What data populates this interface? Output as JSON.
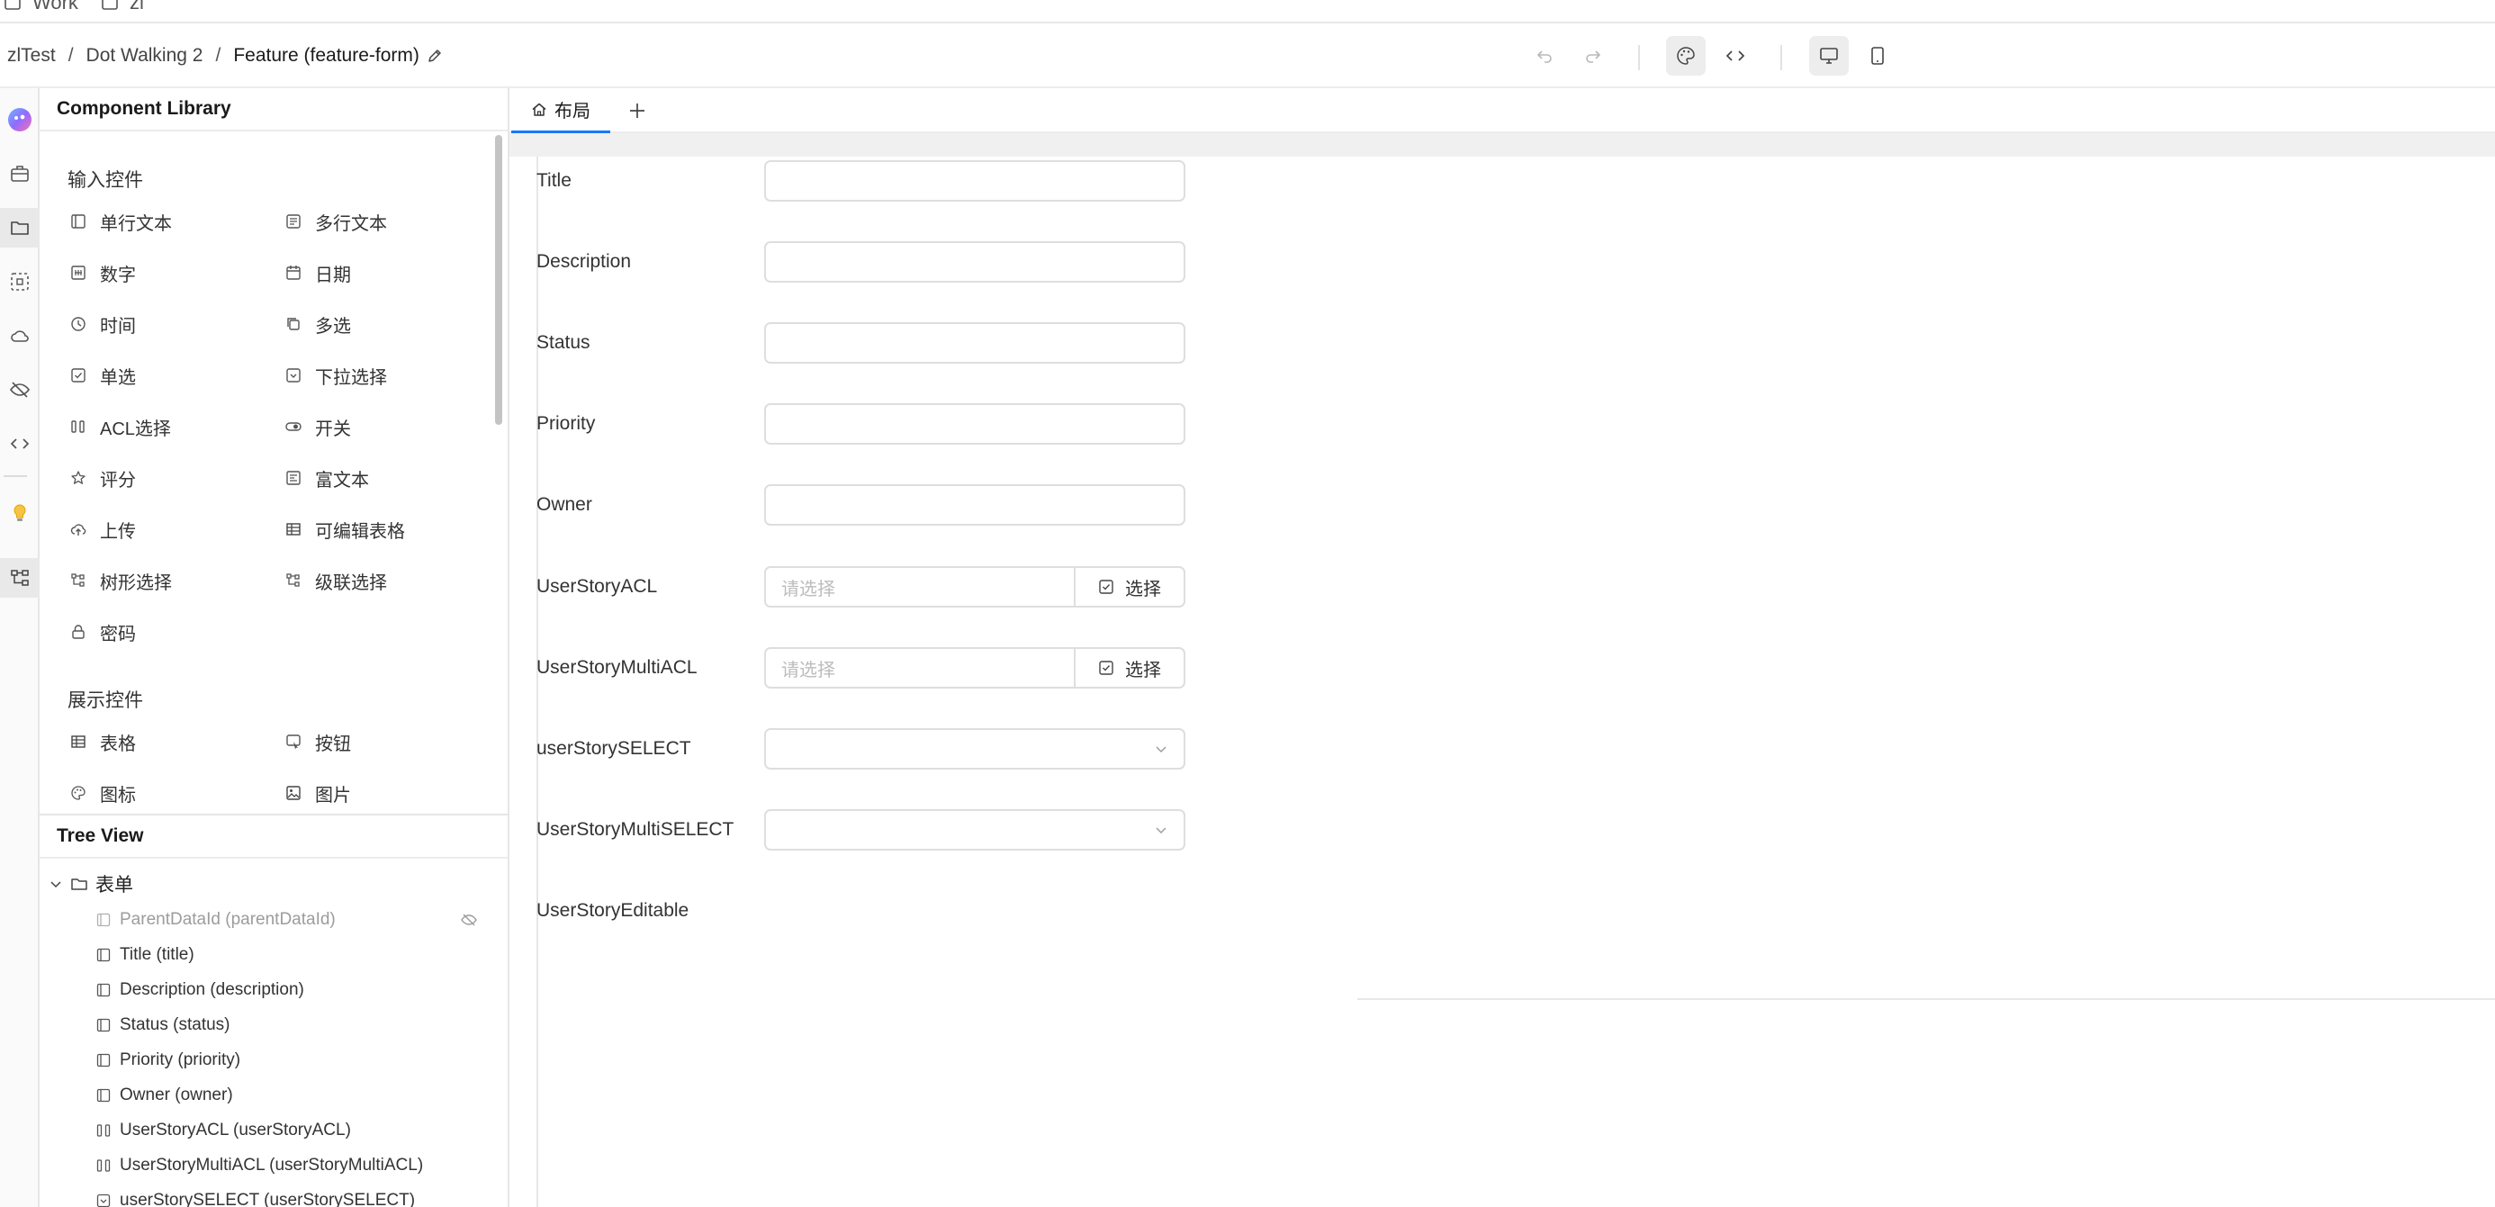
{
  "topbar": {
    "tabs": [
      {
        "label": "Work",
        "icon": "briefcase-icon"
      },
      {
        "label": "zl",
        "icon": "folder-icon"
      }
    ]
  },
  "header": {
    "breadcrumb": [
      {
        "label": "zlTest"
      },
      {
        "label": "Dot Walking 2"
      },
      {
        "label": "Feature (feature-form)"
      }
    ],
    "separator": "/",
    "toolbar_icons": [
      "undo-icon",
      "redo-icon",
      "palette-icon",
      "code-icon",
      "desktop-icon",
      "mobile-icon"
    ]
  },
  "rail": {
    "icons": [
      "avatar",
      "briefcase-icon",
      "folder-icon",
      "selection-icon",
      "cloud-icon",
      "eye-off-icon",
      "code-icon",
      "lightbulb-icon",
      "tree-icon"
    ]
  },
  "library": {
    "title": "Component Library",
    "input_section": "输入控件",
    "input_items": [
      {
        "label": "单行文本",
        "icon": "single-line-icon"
      },
      {
        "label": "多行文本",
        "icon": "multi-line-icon"
      },
      {
        "label": "数字",
        "icon": "number-icon"
      },
      {
        "label": "日期",
        "icon": "calendar-icon"
      },
      {
        "label": "时间",
        "icon": "clock-icon"
      },
      {
        "label": "多选",
        "icon": "copy-icon"
      },
      {
        "label": "单选",
        "icon": "checkbox-icon"
      },
      {
        "label": "下拉选择",
        "icon": "dropdown-icon"
      },
      {
        "label": "ACL选择",
        "icon": "acl-icon"
      },
      {
        "label": "开关",
        "icon": "toggle-icon"
      },
      {
        "label": "评分",
        "icon": "star-icon"
      },
      {
        "label": "富文本",
        "icon": "rich-text-icon"
      },
      {
        "label": "上传",
        "icon": "upload-icon"
      },
      {
        "label": "可编辑表格",
        "icon": "table-icon"
      },
      {
        "label": "树形选择",
        "icon": "tree-icon"
      },
      {
        "label": "级联选择",
        "icon": "tree-icon"
      },
      {
        "label": "密码",
        "icon": "lock-icon"
      }
    ],
    "display_section": "展示控件",
    "display_items": [
      {
        "label": "表格",
        "icon": "table-icon"
      },
      {
        "label": "按钮",
        "icon": "button-icon"
      },
      {
        "label": "图标",
        "icon": "palette-icon"
      },
      {
        "label": "图片",
        "icon": "image-icon"
      }
    ]
  },
  "tree": {
    "title": "Tree View",
    "root": "表单",
    "items": [
      {
        "label": "ParentDataId (parentDataId)",
        "icon": "single-line-icon",
        "hidden": true
      },
      {
        "label": "Title (title)",
        "icon": "single-line-icon"
      },
      {
        "label": "Description (description)",
        "icon": "single-line-icon"
      },
      {
        "label": "Status (status)",
        "icon": "single-line-icon"
      },
      {
        "label": "Priority (priority)",
        "icon": "single-line-icon"
      },
      {
        "label": "Owner (owner)",
        "icon": "single-line-icon"
      },
      {
        "label": "UserStoryACL (userStoryACL)",
        "icon": "acl-icon"
      },
      {
        "label": "UserStoryMultiACL (userStoryMultiACL)",
        "icon": "acl-icon"
      },
      {
        "label": "userStorySELECT (userStorySELECT)",
        "icon": "dropdown-icon"
      }
    ]
  },
  "canvas": {
    "tab_label": "布局",
    "fields": [
      {
        "label": "Title",
        "type": "text"
      },
      {
        "label": "Description",
        "type": "text"
      },
      {
        "label": "Status",
        "type": "text"
      },
      {
        "label": "Priority",
        "type": "text"
      },
      {
        "label": "Owner",
        "type": "text"
      },
      {
        "label": "UserStoryACL",
        "type": "acl",
        "placeholder": "请选择",
        "button": "选择"
      },
      {
        "label": "UserStoryMultiACL",
        "type": "acl",
        "placeholder": "请选择",
        "button": "选择"
      },
      {
        "label": "userStorySELECT",
        "type": "select"
      },
      {
        "label": "UserStoryMultiSELECT",
        "type": "select"
      },
      {
        "label": "UserStoryEditable",
        "type": "editable"
      }
    ]
  },
  "colors": {
    "accent": "#1677ff",
    "border": "#dedede",
    "muted_text": "#9c9c9c",
    "panel_bg": "#fafafa"
  }
}
